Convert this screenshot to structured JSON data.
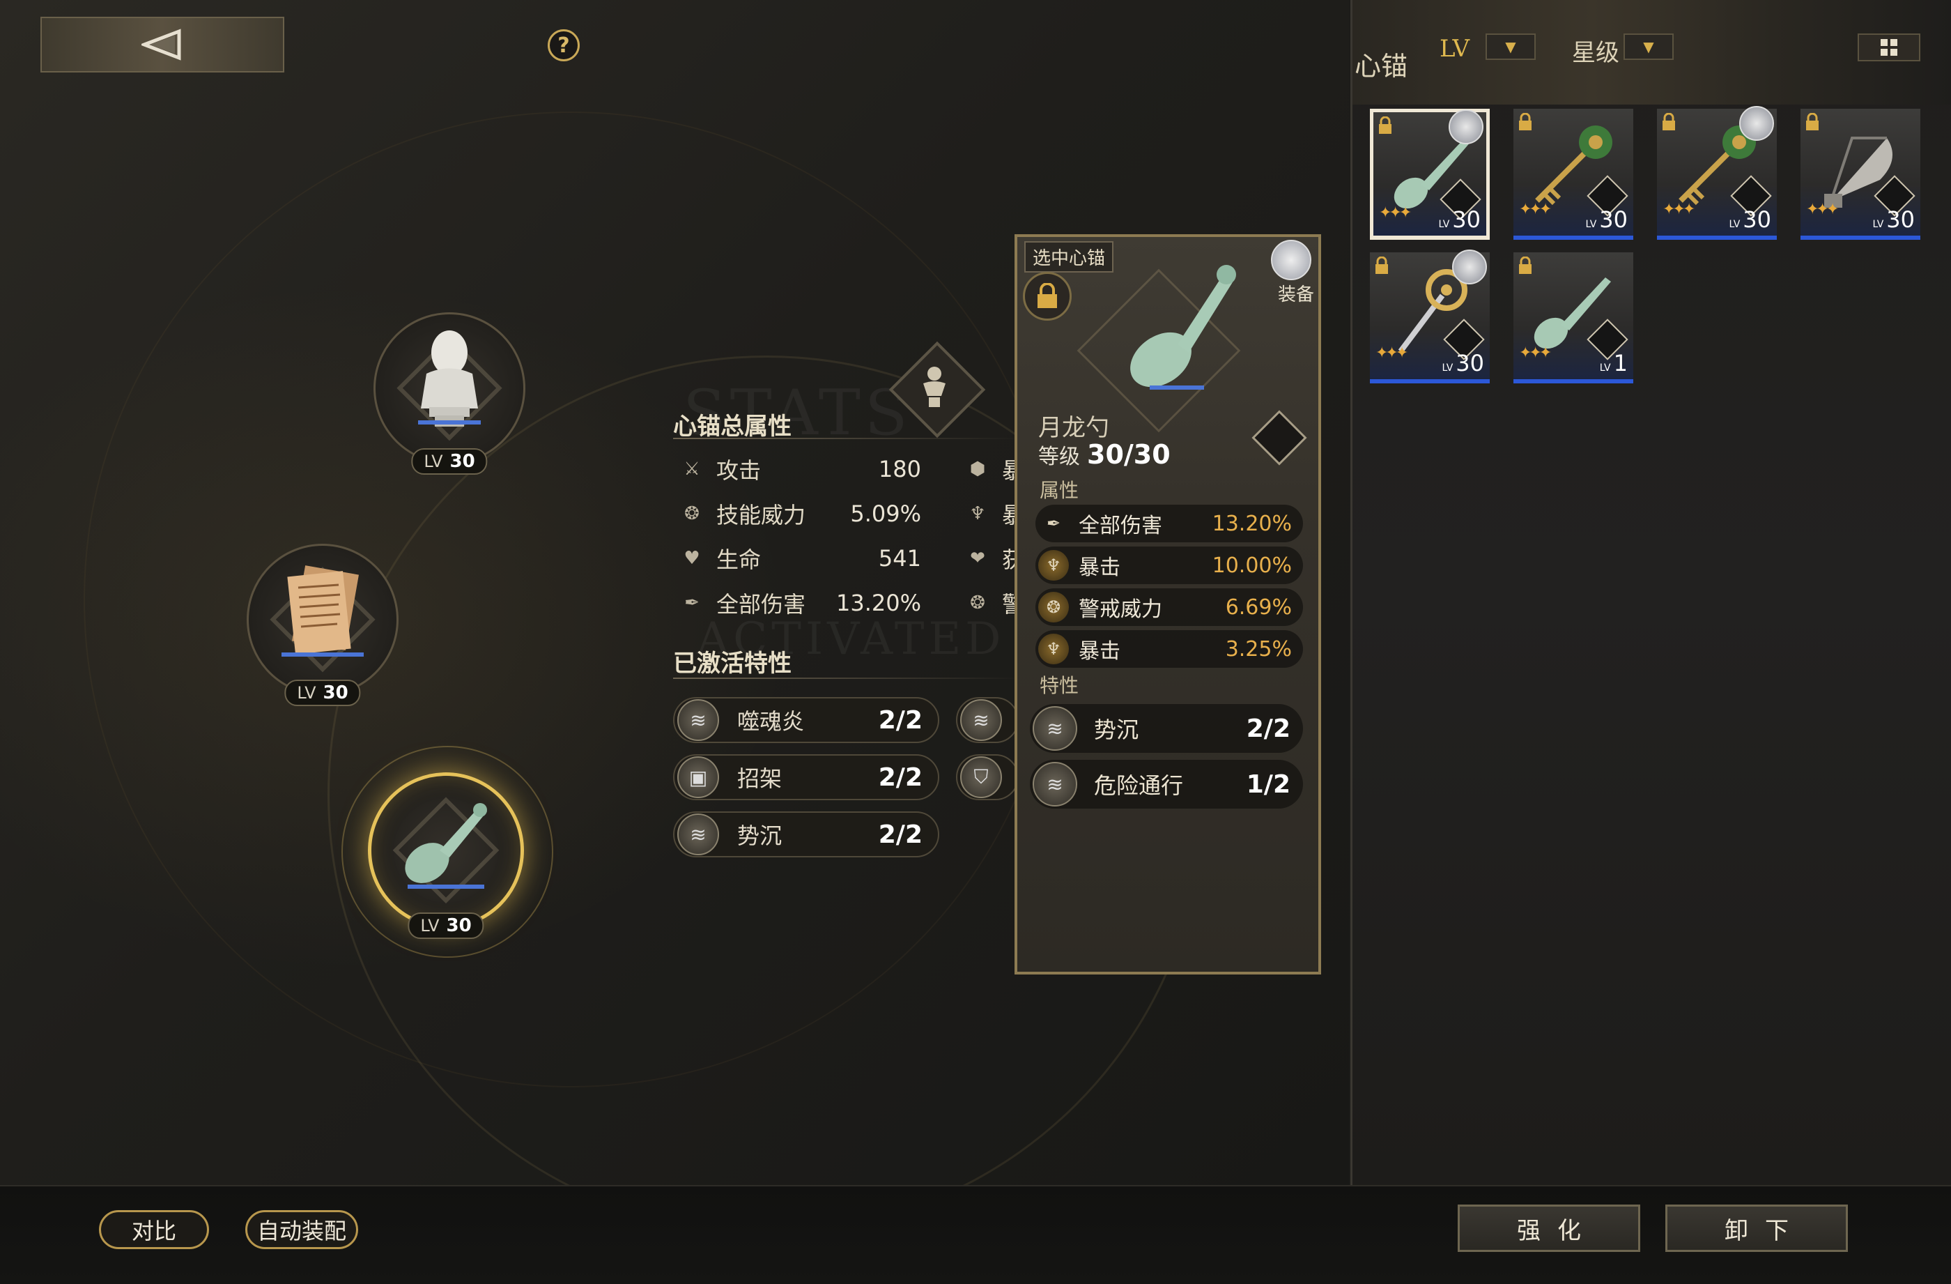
{
  "right_panel": {
    "title": "心锚",
    "sort_lv": "LV",
    "sort_star": "星级",
    "cards": [
      {
        "level": "30",
        "lv": "LV",
        "item": "spoon",
        "selected": true,
        "avatar": true
      },
      {
        "level": "30",
        "lv": "LV",
        "item": "key-green",
        "selected": false,
        "avatar": false
      },
      {
        "level": "30",
        "lv": "LV",
        "item": "key-green",
        "selected": false,
        "avatar": true
      },
      {
        "level": "30",
        "lv": "LV",
        "item": "fan",
        "selected": false,
        "avatar": false
      },
      {
        "level": "30",
        "lv": "LV",
        "item": "key-gold",
        "selected": false,
        "avatar": true
      },
      {
        "level": "1",
        "lv": "LV",
        "item": "spoon",
        "selected": false,
        "avatar": false
      }
    ]
  },
  "slots": [
    {
      "lv": "LV",
      "level": "30",
      "item": "bust"
    },
    {
      "lv": "LV",
      "level": "30",
      "item": "paper"
    },
    {
      "lv": "LV",
      "level": "30",
      "item": "spoon"
    }
  ],
  "stats": {
    "title": "心锚总属性",
    "rows": [
      {
        "icon": "attack-icon",
        "label": "攻击",
        "value": "180"
      },
      {
        "icon": "skill-power-icon",
        "label": "技能威力",
        "value": "5.09%"
      },
      {
        "icon": "hp-icon",
        "label": "生命",
        "value": "541"
      },
      {
        "icon": "all-damage-icon",
        "label": "全部伤害",
        "value": "13.20%"
      }
    ],
    "right_col_partial": [
      "暴",
      "暴",
      "获",
      "警"
    ]
  },
  "traits": {
    "title": "已激活特性",
    "items": [
      {
        "name": "噬魂炎",
        "count": "2/2"
      },
      {
        "name": "招架",
        "count": "2/2"
      },
      {
        "name": "势沉",
        "count": "2/2"
      }
    ]
  },
  "detail": {
    "tag": "选中心锚",
    "equip": "装备",
    "name": "月龙勺",
    "level_label": "等级",
    "level": "30/30",
    "attr_title": "属性",
    "attrs": [
      {
        "label": "全部伤害",
        "value": "13.20%"
      },
      {
        "label": "暴击",
        "value": "10.00%"
      },
      {
        "label": "警戒威力",
        "value": "6.69%"
      },
      {
        "label": "暴击",
        "value": "3.25%"
      }
    ],
    "trait_title": "特性",
    "traits": [
      {
        "name": "势沉",
        "count": "2/2"
      },
      {
        "name": "危险通行",
        "count": "1/2"
      }
    ]
  },
  "bottom": {
    "compare": "对比",
    "auto_equip": "自动装配",
    "enhance": "强化",
    "unequip": "卸下"
  },
  "colors": {
    "accent_gold": "#e6c25a",
    "value_orange": "#e8b04c",
    "card_blue": "#2c58d8"
  }
}
